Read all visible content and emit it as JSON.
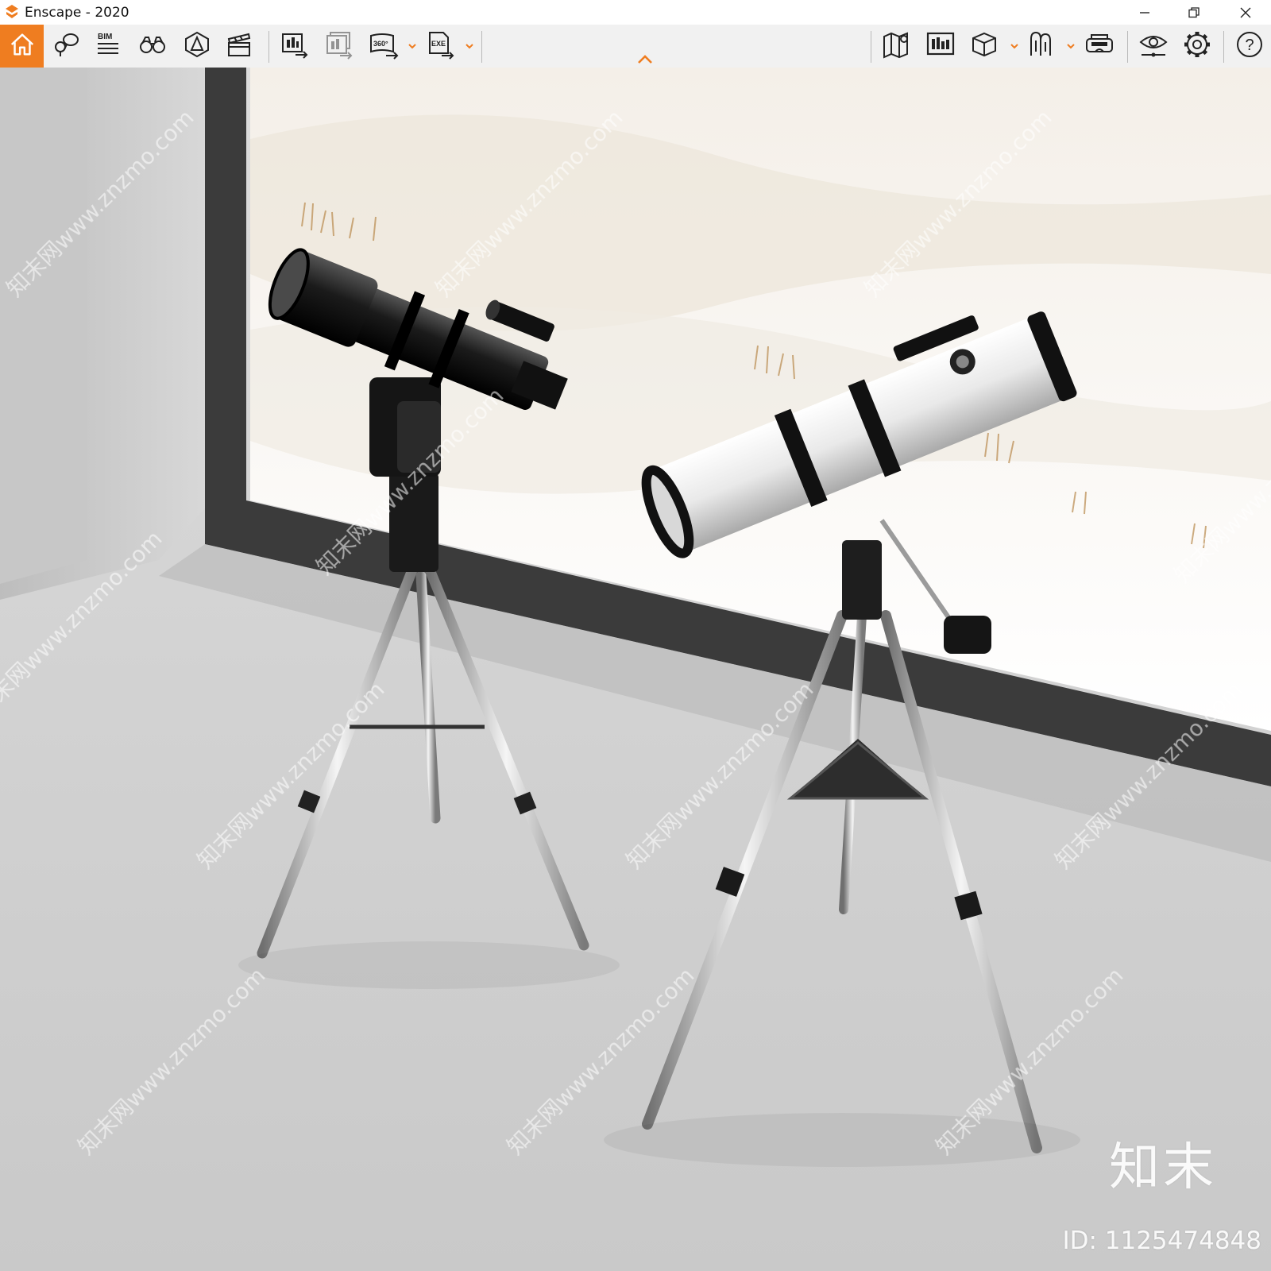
{
  "window": {
    "title": "Enscape - 2020",
    "accent_color": "#ef7d20",
    "controls": [
      "minimize-icon",
      "restore-icon",
      "close-icon"
    ]
  },
  "toolbar": {
    "left_tools": [
      {
        "name": "home-icon",
        "active": true
      },
      {
        "name": "views-icon"
      },
      {
        "name": "bim-icon",
        "label": "BIM"
      },
      {
        "name": "binoculars-icon"
      },
      {
        "name": "atmosphere-icon"
      },
      {
        "name": "video-editor-icon"
      },
      {
        "name": "screenshot-export-icon"
      },
      {
        "name": "batch-render-icon"
      },
      {
        "name": "panorama-export-icon",
        "label": "360°"
      },
      {
        "name": "exe-export-icon",
        "label": "EXE"
      }
    ],
    "right_tools": [
      {
        "name": "map-icon"
      },
      {
        "name": "web-standalone-icon"
      },
      {
        "name": "asset-library-icon"
      },
      {
        "name": "material-editor-icon"
      },
      {
        "name": "vr-headset-icon"
      },
      {
        "name": "visual-settings-icon"
      },
      {
        "name": "settings-gear-icon"
      },
      {
        "name": "help-icon",
        "label": "?"
      }
    ]
  },
  "viewport": {
    "scene": "render of two telescopes on tripods beside a window overlooking sand dunes"
  },
  "watermark": {
    "repeated_text": "知末网www.znzmo.com",
    "brand": "知末",
    "id_text": "ID: 1125474848"
  }
}
